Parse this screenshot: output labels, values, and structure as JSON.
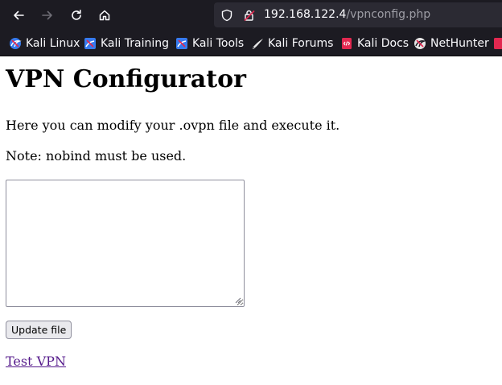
{
  "browser": {
    "url": {
      "host": "192.168.122.4",
      "path": "/vpnconfig.php"
    },
    "nav": {
      "back": "back-arrow-icon",
      "forward": "forward-arrow-icon",
      "reload": "reload-icon",
      "home": "home-icon"
    },
    "bookmarks": [
      {
        "label": "Kali Linux",
        "icon": "kali-dragon-icon"
      },
      {
        "label": "Kali Training",
        "icon": "kali-training-icon"
      },
      {
        "label": "Kali Tools",
        "icon": "kali-tools-icon"
      },
      {
        "label": "Kali Forums",
        "icon": "kali-forums-icon"
      },
      {
        "label": "Kali Docs",
        "icon": "kali-docs-icon"
      },
      {
        "label": "NetHunter",
        "icon": "nethunter-icon"
      },
      {
        "label": "",
        "icon": "bookmark-overflow-icon"
      }
    ]
  },
  "page": {
    "title": "VPN Configurator",
    "intro": "Here you can modify your .ovpn file and execute it.",
    "note": "Note: nobind must be used.",
    "textarea_value": "",
    "update_button": "Update file",
    "test_link": "Test VPN"
  },
  "colors": {
    "chrome_bg": "#1c1b22",
    "urlbar_bg": "#2b2a33",
    "link_visited": "#551a8b",
    "button_bg": "#e9e9ed"
  }
}
